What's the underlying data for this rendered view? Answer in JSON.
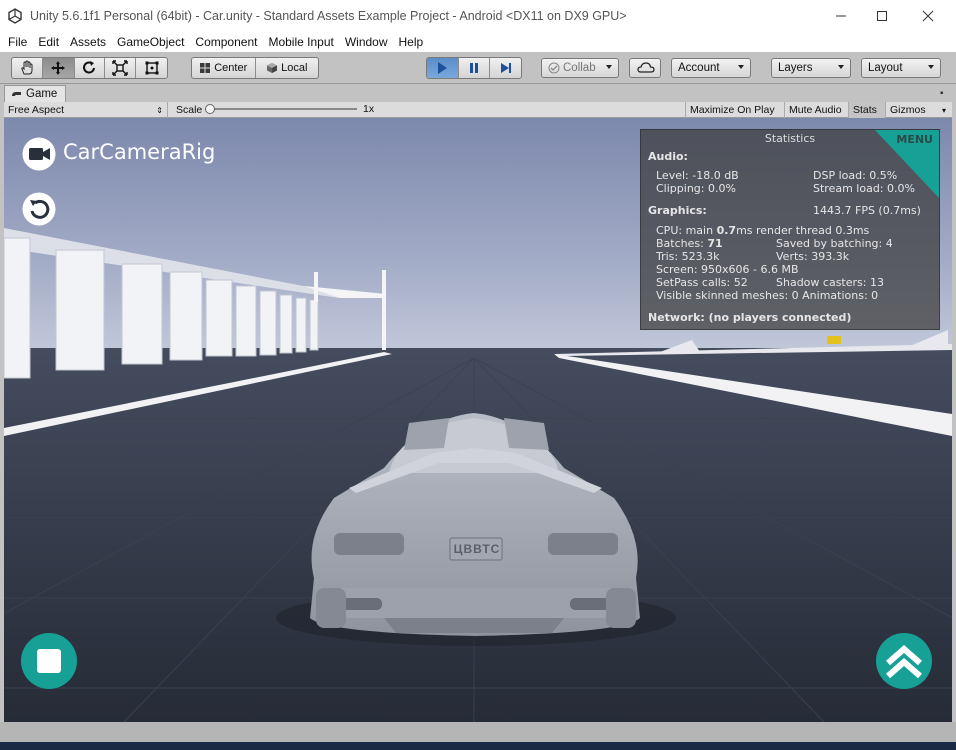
{
  "window": {
    "title": "Unity 5.6.1f1 Personal (64bit) - Car.unity - Standard Assets Example Project - Android <DX11 on DX9 GPU>",
    "minimize_icon": "minimize-icon",
    "maximize_icon": "maximize-icon",
    "close_icon": "close-icon"
  },
  "menu": [
    "File",
    "Edit",
    "Assets",
    "GameObject",
    "Component",
    "Mobile Input",
    "Window",
    "Help"
  ],
  "toolbar": {
    "pivot_center": "Center",
    "pivot_local": "Local",
    "collab": "Collab",
    "account": "Account",
    "layers": "Layers",
    "layout": "Layout",
    "tools": [
      "hand-icon",
      "move-icon",
      "rotate-icon",
      "scale-icon",
      "rect-tool-icon"
    ],
    "playback": [
      "play-icon",
      "pause-icon",
      "step-icon"
    ]
  },
  "game_tab": {
    "label": "Game",
    "aspect": "Free Aspect",
    "scale_label": "Scale",
    "scale_value": "1x",
    "maximize_on_play": "Maximize On Play",
    "mute_audio": "Mute Audio",
    "stats": "Stats",
    "gizmos": "Gizmos"
  },
  "game_view": {
    "camera_label": "CarCameraRig",
    "plate": "ЦВВТС",
    "colors": {
      "teal": "#17a096",
      "sky_top": "#8590b2",
      "road": "#2d3340"
    }
  },
  "statistics": {
    "title": "Statistics",
    "menu": "MENU",
    "audio_header": "Audio:",
    "level": "Level: -18.0 dB",
    "clipping": "Clipping: 0.0%",
    "dsp_load": "DSP load: 0.5%",
    "stream_load": "Stream load: 0.0%",
    "graphics_header": "Graphics:",
    "fps": "1443.7 FPS (0.7ms)",
    "cpu_pre": "CPU: main ",
    "cpu_main": "0.7",
    "cpu_post": "ms  render thread 0.3ms",
    "batches_pre": "Batches: ",
    "batches_val": "71",
    "saved_batching": "Saved by batching: 4",
    "tris": "Tris: 523.3k",
    "verts": "Verts: 393.3k",
    "screen": "Screen: 950x606 - 6.6 MB",
    "setpass": "SetPass calls: 52",
    "shadow_casters": "Shadow casters: 13",
    "skinned": "Visible skinned meshes: 0  Animations: 0",
    "network": "Network: (no players connected)"
  }
}
